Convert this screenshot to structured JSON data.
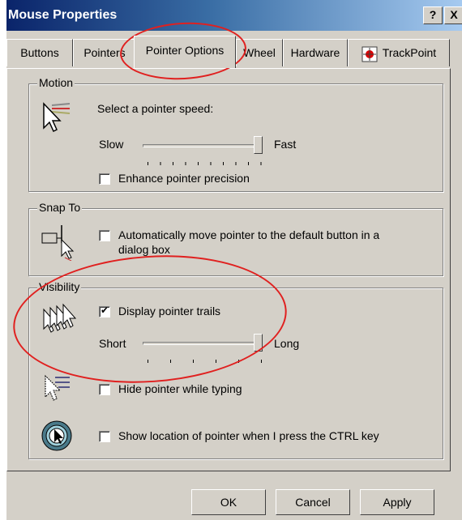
{
  "window": {
    "title": "Mouse Properties",
    "help_label": "?",
    "close_label": "X"
  },
  "tabs": [
    {
      "label": "Buttons"
    },
    {
      "label": "Pointers"
    },
    {
      "label": "Pointer Options",
      "active": true
    },
    {
      "label": "Wheel"
    },
    {
      "label": "Hardware"
    },
    {
      "label": "TrackPoint"
    }
  ],
  "motion": {
    "legend": "Motion",
    "speed_label": "Select a pointer speed:",
    "slow_label": "Slow",
    "fast_label": "Fast",
    "speed_level": 1.0,
    "enhance_label": "Enhance pointer precision",
    "enhance_checked": false
  },
  "snap_to": {
    "legend": "Snap To",
    "auto_label_line1": "Automatically move pointer to the default button in a",
    "auto_label_line2": "dialog box",
    "auto_checked": false
  },
  "visibility": {
    "legend": "Visibility",
    "trails_label": "Display pointer trails",
    "trails_checked": true,
    "short_label": "Short",
    "long_label": "Long",
    "trail_level": 1.0,
    "hide_label": "Hide pointer while typing",
    "hide_checked": false,
    "show_location_label": "Show location of pointer when I press the CTRL key",
    "show_location_checked": false
  },
  "buttons": {
    "ok": "OK",
    "cancel": "Cancel",
    "apply": "Apply"
  },
  "colors": {
    "titlebar_start": "#0a246a",
    "titlebar_end": "#a6caf0",
    "annotation": "#e0201f",
    "face": "#d4d0c8"
  }
}
